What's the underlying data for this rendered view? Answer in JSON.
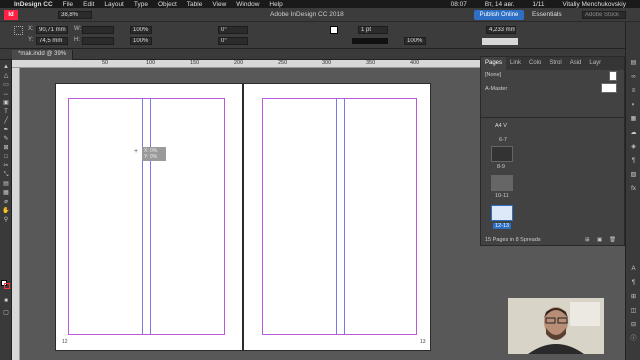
{
  "menubar": {
    "app": "InDesign CC",
    "items": [
      "File",
      "Edit",
      "Layout",
      "Type",
      "Object",
      "Table",
      "View",
      "Window",
      "Help"
    ],
    "right": [
      "08:07",
      "Вт, 14 авг.",
      "1/11",
      "Vitaliy Menchukovskiy"
    ]
  },
  "appbar": {
    "zoom": "38,8%",
    "title": "Adobe InDesign CC 2018",
    "publish": "Publish Online",
    "workspace": "Essentials",
    "search_placeholder": "Adobe Stock"
  },
  "control": {
    "x_label": "X:",
    "x_value": "90,71 mm",
    "y_label": "Y:",
    "y_value": "74,5 mm",
    "w_label": "W:",
    "h_label": "H:",
    "scale1": "100%",
    "scale2": "100%",
    "angle1": "0°",
    "angle2": "0°",
    "stroke": "1 pt",
    "opacity": "100%",
    "dim": "4,233 mm"
  },
  "document": {
    "tab": "*mak.indd @ 39%"
  },
  "ruler": {
    "ticks": [
      "50",
      "100",
      "150",
      "200",
      "250",
      "300",
      "350",
      "400"
    ]
  },
  "canvas": {
    "tooltip_x": "X: 0%",
    "tooltip_y": "Y: 0%",
    "page_left_num": "12",
    "page_right_num": "13"
  },
  "pages_panel": {
    "tabs": [
      "Pages",
      "Link",
      "Colo",
      "Strol",
      "Asid",
      "Layr"
    ],
    "none": "[None]",
    "master": "A-Master",
    "size": "A4 V",
    "spreads": [
      "6-7",
      "8-9",
      "10-11",
      "12-13"
    ],
    "status": "15 Pages in 8 Spreads"
  },
  "colors": {
    "accent": "#2d6fc4",
    "margin": "#b65ad6",
    "page": "#ffffff",
    "pasteboard": "#585858"
  }
}
